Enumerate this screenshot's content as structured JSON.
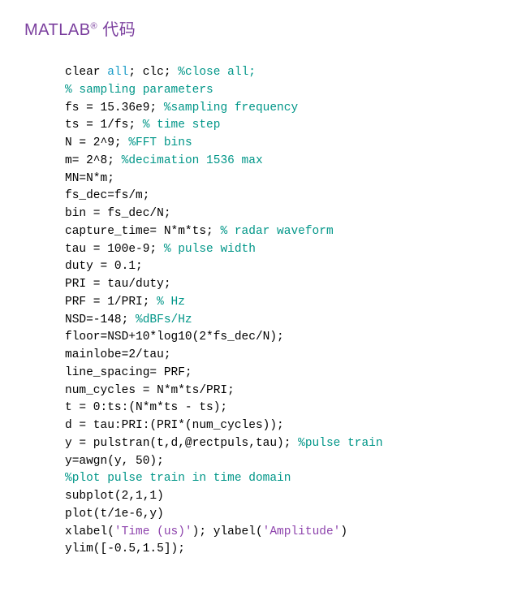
{
  "title": {
    "prefix": "MATLAB",
    "reg": "®",
    "suffix": " 代码"
  },
  "code": {
    "l1_a": "clear ",
    "l1_b": "all",
    "l1_c": "; clc; ",
    "l1_d": "%close all;",
    "l2": "% sampling parameters",
    "l3_a": "fs = 15.36e9; ",
    "l3_b": "%sampling frequency",
    "l4_a": "ts = 1/fs; ",
    "l4_b": "% time step",
    "l5_a": "N = 2^9; ",
    "l5_b": "%FFT bins",
    "l6_a": "m= 2^8; ",
    "l6_b": "%decimation 1536 max",
    "l7": "MN=N*m;",
    "l8": "fs_dec=fs/m;",
    "l9": "bin = fs_dec/N;",
    "l10_a": "capture_time= N*m*ts; ",
    "l10_b": "% radar waveform",
    "l11_a": "tau = 100e-9; ",
    "l11_b": "% pulse width",
    "l12": "duty = 0.1;",
    "l13": "PRI = tau/duty;",
    "l14_a": "PRF = 1/PRI; ",
    "l14_b": "% Hz",
    "l15_a": "NSD=-148; ",
    "l15_b": "%dBFs/Hz",
    "l16": "floor=NSD+10*log10(2*fs_dec/N);",
    "l17": "mainlobe=2/tau;",
    "l18": "line_spacing= PRF;",
    "l19": "num_cycles = N*m*ts/PRI;",
    "l20": "t = 0:ts:(N*m*ts - ts);",
    "l21": "d = tau:PRI:(PRI*(num_cycles));",
    "l22_a": "y = pulstran(t,d,@rectpuls,tau); ",
    "l22_b": "%pulse train",
    "l23": "y=awgn(y, 50);",
    "l24": "%plot pulse train in time domain",
    "l25": "subplot(2,1,1)",
    "l26": "plot(t/1e-6,y)",
    "l27_a": "xlabel(",
    "l27_b": "'Time (us)'",
    "l27_c": "); ylabel(",
    "l27_d": "'Amplitude'",
    "l27_e": ")",
    "l28": "ylim([-0.5,1.5]);"
  }
}
